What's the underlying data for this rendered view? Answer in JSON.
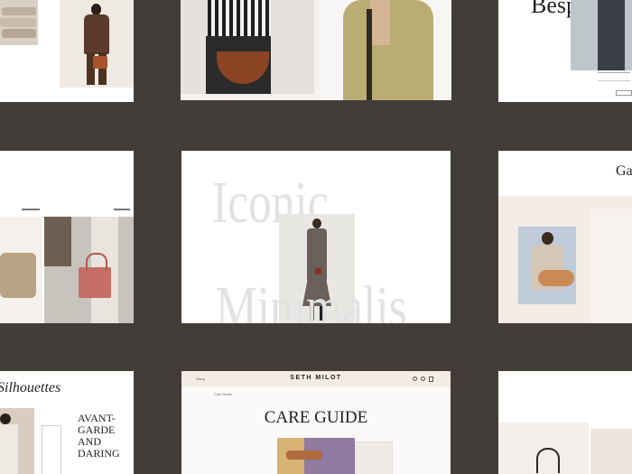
{
  "colors": {
    "background": "#423d38",
    "card": "#ffffff",
    "cream": "#f3ece4",
    "accent": "#b25a4b"
  },
  "grid": {
    "tile_bespoke": {
      "heading": "Bespoke"
    },
    "tile_iconic": {
      "heading_line1": "Iconic",
      "heading_line2": "Minimalis"
    },
    "tile_gallery": {
      "heading": "Gal"
    },
    "tile_avant": {
      "heading": "Avant-Garde and Daring"
    },
    "tile_silhouettes": {
      "heading": "Silhouettes"
    },
    "tile_care": {
      "brand": "SETH MILOT",
      "nav_left": "Shop",
      "breadcrumb": "Care Guide",
      "title": "CARE GUIDE"
    }
  }
}
